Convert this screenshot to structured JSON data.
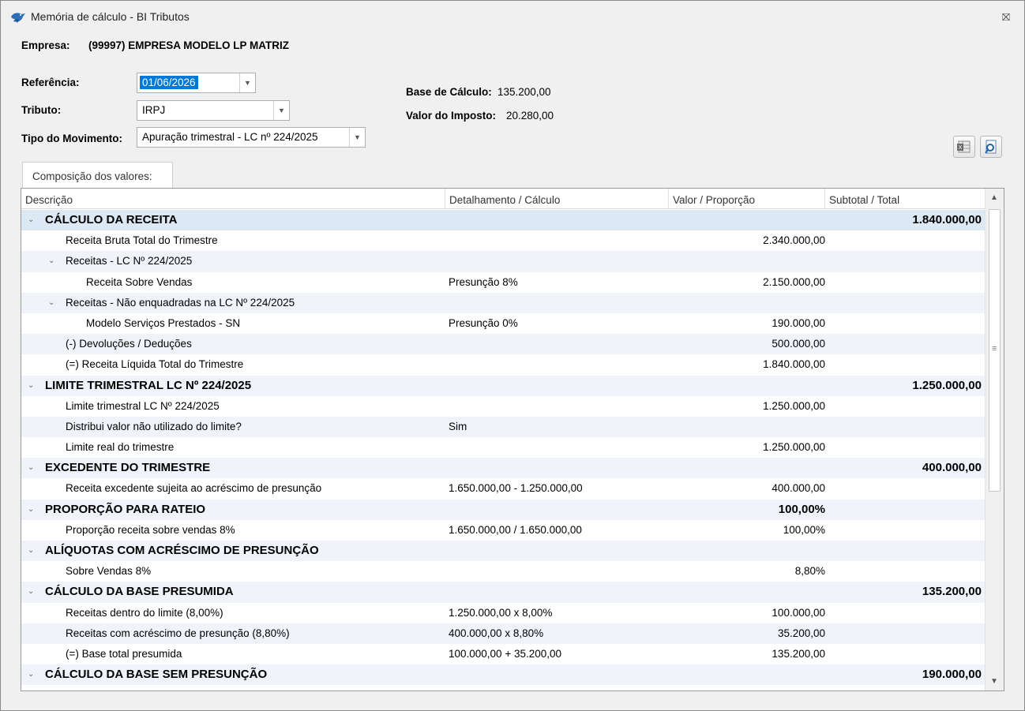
{
  "window": {
    "title": "Memória de cálculo - BI Tributos",
    "close_glyph": "⛝",
    "icon": "bird-logo-icon"
  },
  "header": {
    "empresa_label": "Empresa:",
    "empresa_value": "(99997) EMPRESA MODELO LP MATRIZ",
    "referencia_label": "Referência:",
    "referencia_value": "01/06/2026",
    "tributo_label": "Tributo:",
    "tributo_value": "IRPJ",
    "tipo_label": "Tipo do Movimento:",
    "tipo_value": "Apuração trimestral - LC nº 224/2025",
    "base_label": "Base de Cálculo:",
    "base_value": "135.200,00",
    "imposto_label": "Valor do Imposto:",
    "imposto_value": "20.280,00"
  },
  "toolbar": {
    "excel_icon": "excel-export-icon",
    "preview_icon": "print-preview-icon"
  },
  "tab": {
    "label": "Composição dos valores:"
  },
  "grid": {
    "columns": [
      "Descrição",
      "Detalhamento / Cálculo",
      "Valor / Proporção",
      "Subtotal / Total"
    ],
    "rows": [
      {
        "level": 0,
        "group": true,
        "chevron": true,
        "desc": "CÁLCULO DA RECEITA",
        "det": "",
        "val": "",
        "tot": "1.840.000,00"
      },
      {
        "level": 1,
        "group": false,
        "chevron": false,
        "desc": "Receita Bruta Total do Trimestre",
        "det": "",
        "val": "2.340.000,00",
        "tot": ""
      },
      {
        "level": 1,
        "group": false,
        "chevron": true,
        "desc": "Receitas - LC Nº 224/2025",
        "det": "",
        "val": "",
        "tot": ""
      },
      {
        "level": 2,
        "group": false,
        "chevron": false,
        "desc": "Receita Sobre Vendas",
        "det": "Presunção 8%",
        "val": "2.150.000,00",
        "tot": ""
      },
      {
        "level": 1,
        "group": false,
        "chevron": true,
        "desc": "Receitas - Não enquadradas na LC Nº 224/2025",
        "det": "",
        "val": "",
        "tot": ""
      },
      {
        "level": 2,
        "group": false,
        "chevron": false,
        "desc": "Modelo Serviços Prestados - SN",
        "det": "Presunção 0%",
        "val": "190.000,00",
        "tot": ""
      },
      {
        "level": 1,
        "group": false,
        "chevron": false,
        "desc": "(-) Devoluções / Deduções",
        "det": "",
        "val": "500.000,00",
        "tot": ""
      },
      {
        "level": 1,
        "group": false,
        "chevron": false,
        "desc": "(=) Receita Líquida Total do Trimestre",
        "det": "",
        "val": "1.840.000,00",
        "tot": ""
      },
      {
        "level": 0,
        "group": true,
        "chevron": true,
        "desc": "LIMITE TRIMESTRAL LC Nº 224/2025",
        "det": "",
        "val": "",
        "tot": "1.250.000,00"
      },
      {
        "level": 1,
        "group": false,
        "chevron": false,
        "desc": "Limite trimestral LC Nº 224/2025",
        "det": "",
        "val": "1.250.000,00",
        "tot": ""
      },
      {
        "level": 1,
        "group": false,
        "chevron": false,
        "desc": "Distribui valor não utilizado do limite?",
        "det": "Sim",
        "val": "",
        "tot": ""
      },
      {
        "level": 1,
        "group": false,
        "chevron": false,
        "desc": "Limite real do trimestre",
        "det": "",
        "val": "1.250.000,00",
        "tot": ""
      },
      {
        "level": 0,
        "group": true,
        "chevron": true,
        "desc": "EXCEDENTE DO TRIMESTRE",
        "det": "",
        "val": "",
        "tot": "400.000,00"
      },
      {
        "level": 1,
        "group": false,
        "chevron": false,
        "desc": "Receita excedente sujeita ao acréscimo de presunção",
        "det": "1.650.000,00 - 1.250.000,00",
        "val": "400.000,00",
        "tot": ""
      },
      {
        "level": 0,
        "group": true,
        "chevron": true,
        "desc": "PROPORÇÃO PARA RATEIO",
        "det": "",
        "val": "100,00%",
        "tot": ""
      },
      {
        "level": 1,
        "group": false,
        "chevron": false,
        "desc": "Proporção receita sobre vendas 8%",
        "det": "1.650.000,00 / 1.650.000,00",
        "val": "100,00%",
        "tot": ""
      },
      {
        "level": 0,
        "group": true,
        "chevron": true,
        "desc": "ALÍQUOTAS COM ACRÉSCIMO DE PRESUNÇÃO",
        "det": "",
        "val": "",
        "tot": ""
      },
      {
        "level": 1,
        "group": false,
        "chevron": false,
        "desc": "Sobre Vendas 8%",
        "det": "",
        "val": "8,80%",
        "tot": ""
      },
      {
        "level": 0,
        "group": true,
        "chevron": true,
        "desc": "CÁLCULO DA BASE PRESUMIDA",
        "det": "",
        "val": "",
        "tot": "135.200,00"
      },
      {
        "level": 1,
        "group": false,
        "chevron": false,
        "desc": "Receitas dentro do limite (8,00%)",
        "det": "1.250.000,00 x 8,00%",
        "val": "100.000,00",
        "tot": ""
      },
      {
        "level": 1,
        "group": false,
        "chevron": false,
        "desc": "Receitas com acréscimo de presunção (8,80%)",
        "det": "400.000,00 x 8,80%",
        "val": "35.200,00",
        "tot": ""
      },
      {
        "level": 1,
        "group": false,
        "chevron": false,
        "desc": "(=) Base total presumida",
        "det": "100.000,00 + 35.200,00",
        "val": "135.200,00",
        "tot": ""
      },
      {
        "level": 0,
        "group": true,
        "chevron": true,
        "desc": "CÁLCULO DA BASE SEM PRESUNÇÃO",
        "det": "",
        "val": "",
        "tot": "190.000,00"
      }
    ]
  }
}
